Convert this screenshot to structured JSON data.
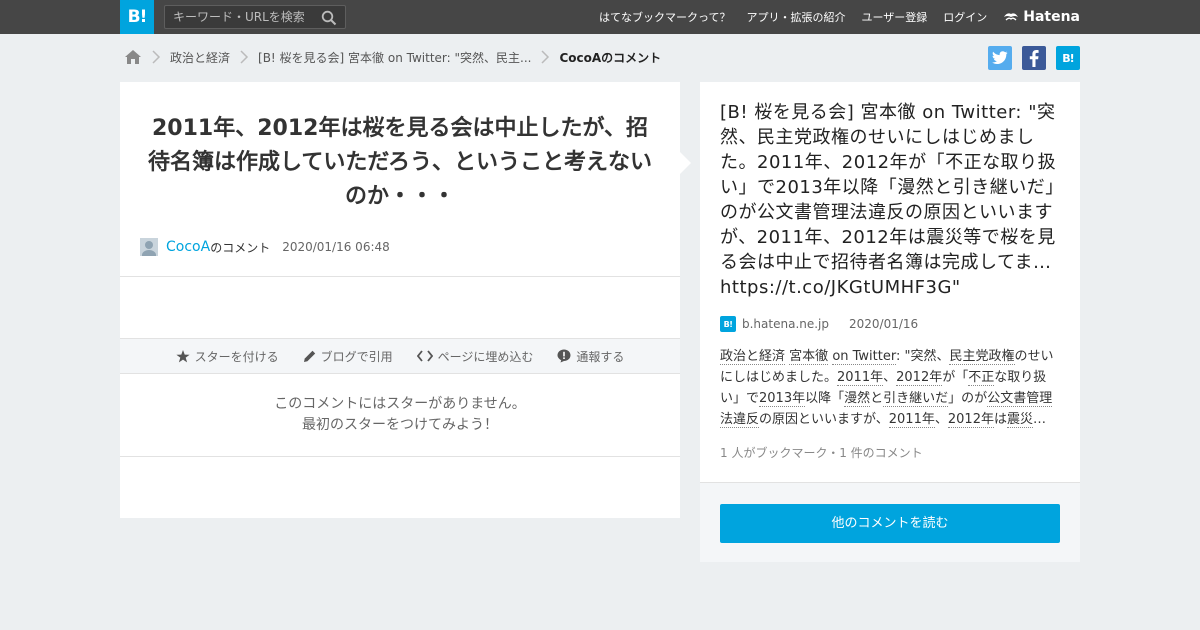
{
  "header": {
    "logo_text": "B!",
    "search_placeholder": "キーワード・URLを検索",
    "nav": [
      "はてなブックマークって？",
      "アプリ・拡張の紹介",
      "ユーザー登録",
      "ログイン"
    ],
    "brand": "Hatena"
  },
  "breadcrumb": {
    "items": [
      "政治と経済",
      "[B! 桜を見る会] 宮本徹 on Twitter: \"突然、民主...",
      "CocoAのコメント"
    ]
  },
  "share": {
    "hatena_label": "B!"
  },
  "comment": {
    "text": "2011年、2012年は桜を見る会は中止したが、招待名簿は作成していただろう、ということ考えないのか・・・",
    "user": "CocoA",
    "user_suffix": "のコメント",
    "date": "2020/01/16 06:48"
  },
  "actions": {
    "star": "スターを付ける",
    "blog": "ブログで引用",
    "embed": "ページに埋め込む",
    "report": "通報する"
  },
  "stars": {
    "line1": "このコメントにはスターがありません。",
    "line2": "最初のスターをつけてみよう！"
  },
  "entry": {
    "title": "[B! 桜を見る会] 宮本徹 on Twitter: \"突然、民主党政権のせいにしはじめました。2011年、2012年が「不正な取り扱い」で2013年以降「漫然と引き継いだ」のが公文書管理法違反の原因といいますが、2011年、2012年は震災等で桜を見る会は中止で招待者名簿は完成してま… https://t.co/JKGtUMHF3G\"",
    "favicon": "B!",
    "domain": "b.hatena.ne.jp",
    "date": "2020/01/16",
    "description": [
      {
        "t": "政治と経済",
        "kw": true
      },
      {
        "t": " ",
        "kw": false
      },
      {
        "t": "宮本徹",
        "kw": true
      },
      {
        "t": " ",
        "kw": false
      },
      {
        "t": "on Twitter",
        "kw": true
      },
      {
        "t": ": \"突然、",
        "kw": false
      },
      {
        "t": "民主党政権",
        "kw": true
      },
      {
        "t": "のせいにしはじめました。",
        "kw": false
      },
      {
        "t": "2011年",
        "kw": true
      },
      {
        "t": "、",
        "kw": false
      },
      {
        "t": "2012年",
        "kw": true
      },
      {
        "t": "が「",
        "kw": false
      },
      {
        "t": "不正",
        "kw": true
      },
      {
        "t": "な取り扱い」で",
        "kw": false
      },
      {
        "t": "2013年",
        "kw": true
      },
      {
        "t": "以降「",
        "kw": false
      },
      {
        "t": "漫然",
        "kw": true
      },
      {
        "t": "と",
        "kw": false
      },
      {
        "t": "引き継いだ",
        "kw": true
      },
      {
        "t": "」のが",
        "kw": false
      },
      {
        "t": "公文書管理法違反",
        "kw": true
      },
      {
        "t": "の原因といいますが、",
        "kw": false
      },
      {
        "t": "2011年",
        "kw": true
      },
      {
        "t": "、",
        "kw": false
      },
      {
        "t": "2012年",
        "kw": true
      },
      {
        "t": "は",
        "kw": false
      },
      {
        "t": "震災",
        "kw": true
      },
      {
        "t": "…",
        "kw": false
      }
    ],
    "count": "1 人がブックマーク・1 件のコメント"
  },
  "read_more": "他のコメントを読む",
  "colors": {
    "accent": "#00a4de",
    "header_bg": "#464646",
    "page_bg": "#eceff1",
    "twitter": "#55acee",
    "facebook": "#3b5998"
  }
}
